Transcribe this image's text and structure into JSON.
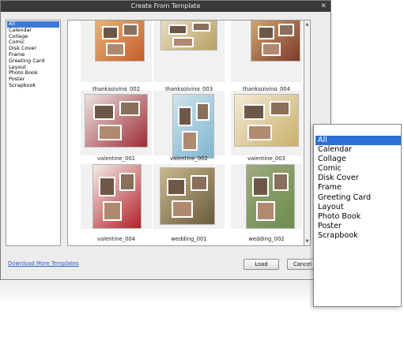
{
  "window": {
    "title": "Create From Template",
    "close_label": "✕"
  },
  "categories": [
    "All",
    "Calendar",
    "Collage",
    "Comic",
    "Disk Cover",
    "Frame",
    "Greeting Card",
    "Layout",
    "Photo Book",
    "Poster",
    "Scrapbook"
  ],
  "selected_category": "All",
  "templates": [
    {
      "name": "thanksgiving_002",
      "accent": "#c65c2b",
      "bg": "#e7b77c"
    },
    {
      "name": "thanksgiving_003",
      "accent": "#b9a164",
      "bg": "#e9dfc2"
    },
    {
      "name": "thanksgiving_004",
      "accent": "#7a3b2a",
      "bg": "#d4a773"
    },
    {
      "name": "valentine_001",
      "accent": "#9d2d37",
      "bg": "#ebe2df"
    },
    {
      "name": "valentine_002",
      "accent": "#7fb7cf",
      "bg": "#cfe2ec"
    },
    {
      "name": "valentine_003",
      "accent": "#c9b16c",
      "bg": "#f4ead6"
    },
    {
      "name": "valentine_004",
      "accent": "#b31f2a",
      "bg": "#f3efe8"
    },
    {
      "name": "wedding_001",
      "accent": "#6b5a3a",
      "bg": "#c9b98f"
    },
    {
      "name": "wedding_002",
      "accent": "#6b8d4c",
      "bg": "#9ea97e"
    }
  ],
  "footer": {
    "download_link": "Download More Templates",
    "load_label": "Load",
    "cancel_label": "Cancel"
  },
  "scroll": {
    "up_icon": "▲",
    "down_icon": "▼"
  }
}
